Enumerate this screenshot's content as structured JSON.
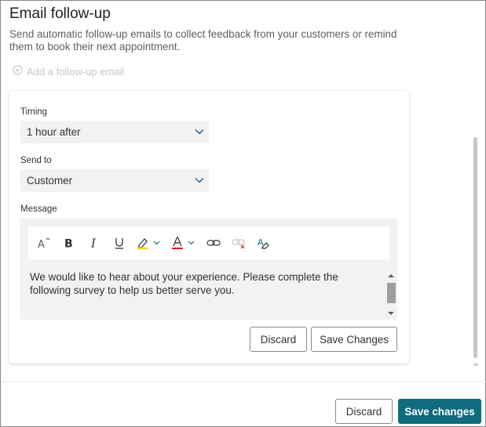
{
  "panel": {
    "title": "Email follow-up",
    "description": "Send automatic follow-up emails to collect feedback from your customers or remind them to book their next appointment.",
    "add_link": "Add a follow-up email"
  },
  "form": {
    "timing_label": "Timing",
    "timing_value": "1 hour after",
    "sendto_label": "Send to",
    "sendto_value": "Customer",
    "message_label": "Message",
    "message_text": "We would like to hear about your experience. Please complete the following survey to help us better serve you.",
    "toolbar_icons": [
      "font-size-icon",
      "bold-icon",
      "italic-icon",
      "underline-icon",
      "highlight-icon",
      "font-color-icon",
      "link-icon",
      "unlink-icon",
      "clear-format-icon"
    ],
    "discard_label": "Discard",
    "save_label": "Save Changes"
  },
  "footer": {
    "discard_label": "Discard",
    "save_label": "Save changes"
  },
  "colors": {
    "primary": "#0f6c7e",
    "chevron": "#0f6c7e",
    "highlight": "#ffd400",
    "font_color": "#e81123"
  }
}
